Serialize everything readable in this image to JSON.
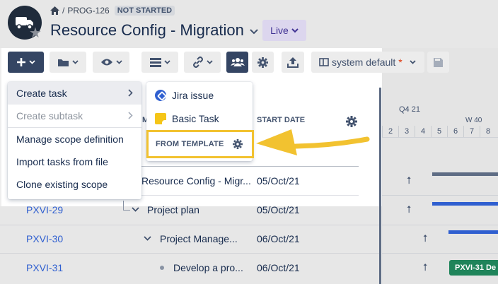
{
  "header": {
    "breadcrumb_project": "PROG-126",
    "breadcrumb_sep": "/",
    "status": "NOT STARTED",
    "title": "Resource Config - Migration",
    "live_label": "Live"
  },
  "toolbar": {
    "view_label": "system default",
    "view_marker": "*"
  },
  "menu": {
    "items": [
      {
        "label": "Create task"
      },
      {
        "label": "Create subtask"
      },
      {
        "label": "Manage scope definition"
      },
      {
        "label": "Import tasks from file"
      },
      {
        "label": "Clone existing scope"
      }
    ]
  },
  "submenu": {
    "jira_issue": "Jira issue",
    "basic_task": "Basic Task",
    "from_template": "FROM TEMPLATE"
  },
  "table": {
    "col_partial": "M",
    "col_start": "START DATE",
    "rows": [
      {
        "key": "",
        "name": "Resource Config - Migr...",
        "start": "05/Oct/21"
      },
      {
        "key": "PXVI-29",
        "name": "Project plan",
        "start": "05/Oct/21"
      },
      {
        "key": "PXVI-30",
        "name": "Project Manage...",
        "start": "06/Oct/21"
      },
      {
        "key": "PXVI-31",
        "name": "Develop a pro...",
        "start": "06/Oct/21"
      }
    ]
  },
  "gantt": {
    "quarter": "Q4 21",
    "week": "W 40",
    "days": [
      "2",
      "3",
      "4",
      "5",
      "6",
      "7",
      "8"
    ],
    "pill_label": "PXVI-31  De"
  },
  "colors": {
    "accent": "#f2c230",
    "primary_button": "#344563",
    "link": "#2f5fd0",
    "gantt_bar": "#2f5fd0",
    "gantt_pill": "#1f845a"
  }
}
